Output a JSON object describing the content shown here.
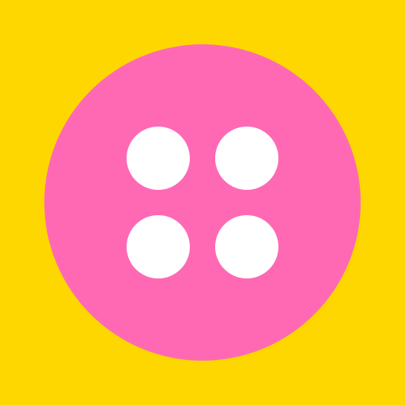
{
  "icon": {
    "name": "sewing-button-icon",
    "background_color": "#FFD700",
    "disc_color": "#FF69B4",
    "hole_color": "#FFFFFF",
    "hole_count": 4
  }
}
